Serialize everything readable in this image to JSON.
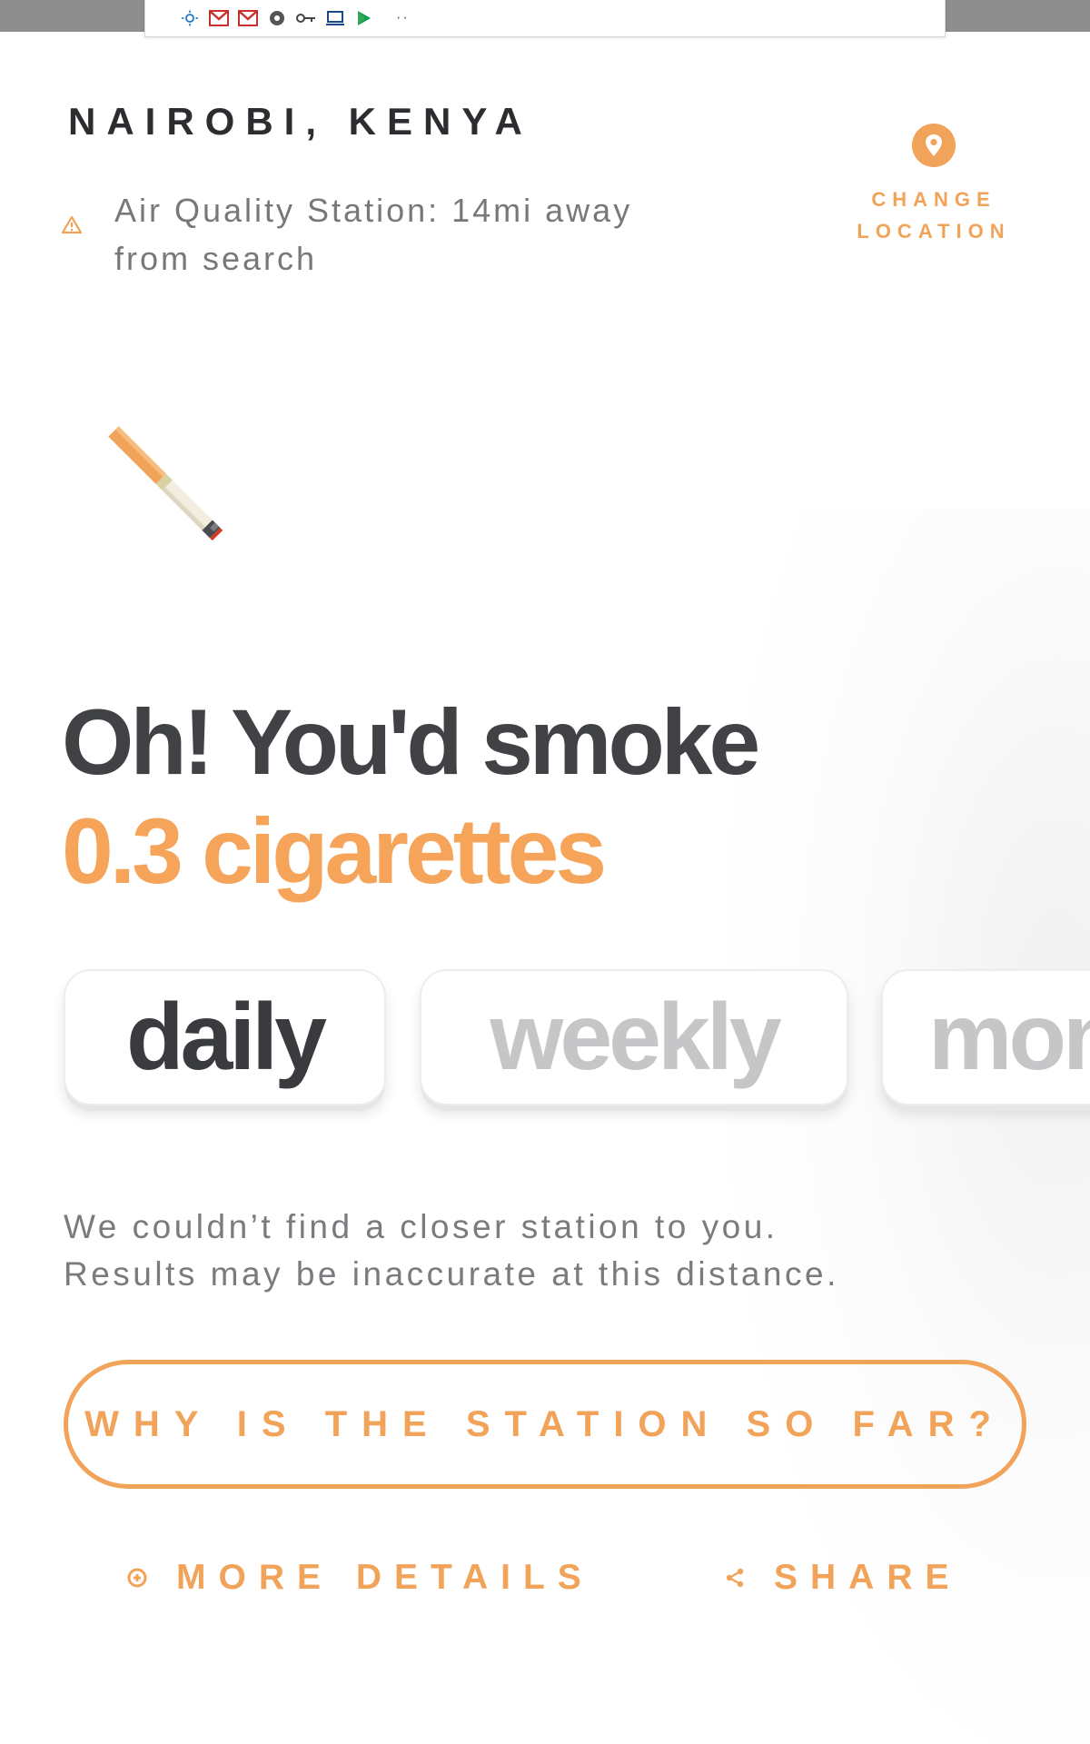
{
  "header": {
    "city": "NAIROBI, KENYA",
    "station_notice_line1": "Air Quality Station: 14mi away",
    "station_notice_line2": "from search",
    "change_location_line1": "CHANGE",
    "change_location_line2": "LOCATION"
  },
  "headline": {
    "line1": "Oh! You'd smoke",
    "line2": "0.3 cigarettes"
  },
  "periods": {
    "daily": "daily",
    "weekly": "weekly",
    "monthly": "monthly",
    "selected": "daily"
  },
  "notice": {
    "line1": "We couldn’t find a closer station to you.",
    "line2": "Results may be inaccurate at this distance."
  },
  "actions": {
    "why_button": "WHY IS THE STATION SO FAR?",
    "more_details": "MORE DETAILS",
    "share": "SHARE"
  },
  "icons": {
    "warning": "warning-triangle-icon",
    "location": "map-pin-icon",
    "cigarette": "cigarette-icon",
    "more_details": "plus-circle-icon",
    "share": "share-icon"
  },
  "colors": {
    "accent": "#f2a35a",
    "headline_dark": "#414246",
    "text_muted": "#77787c",
    "inactive_period": "#c6c6c8"
  }
}
